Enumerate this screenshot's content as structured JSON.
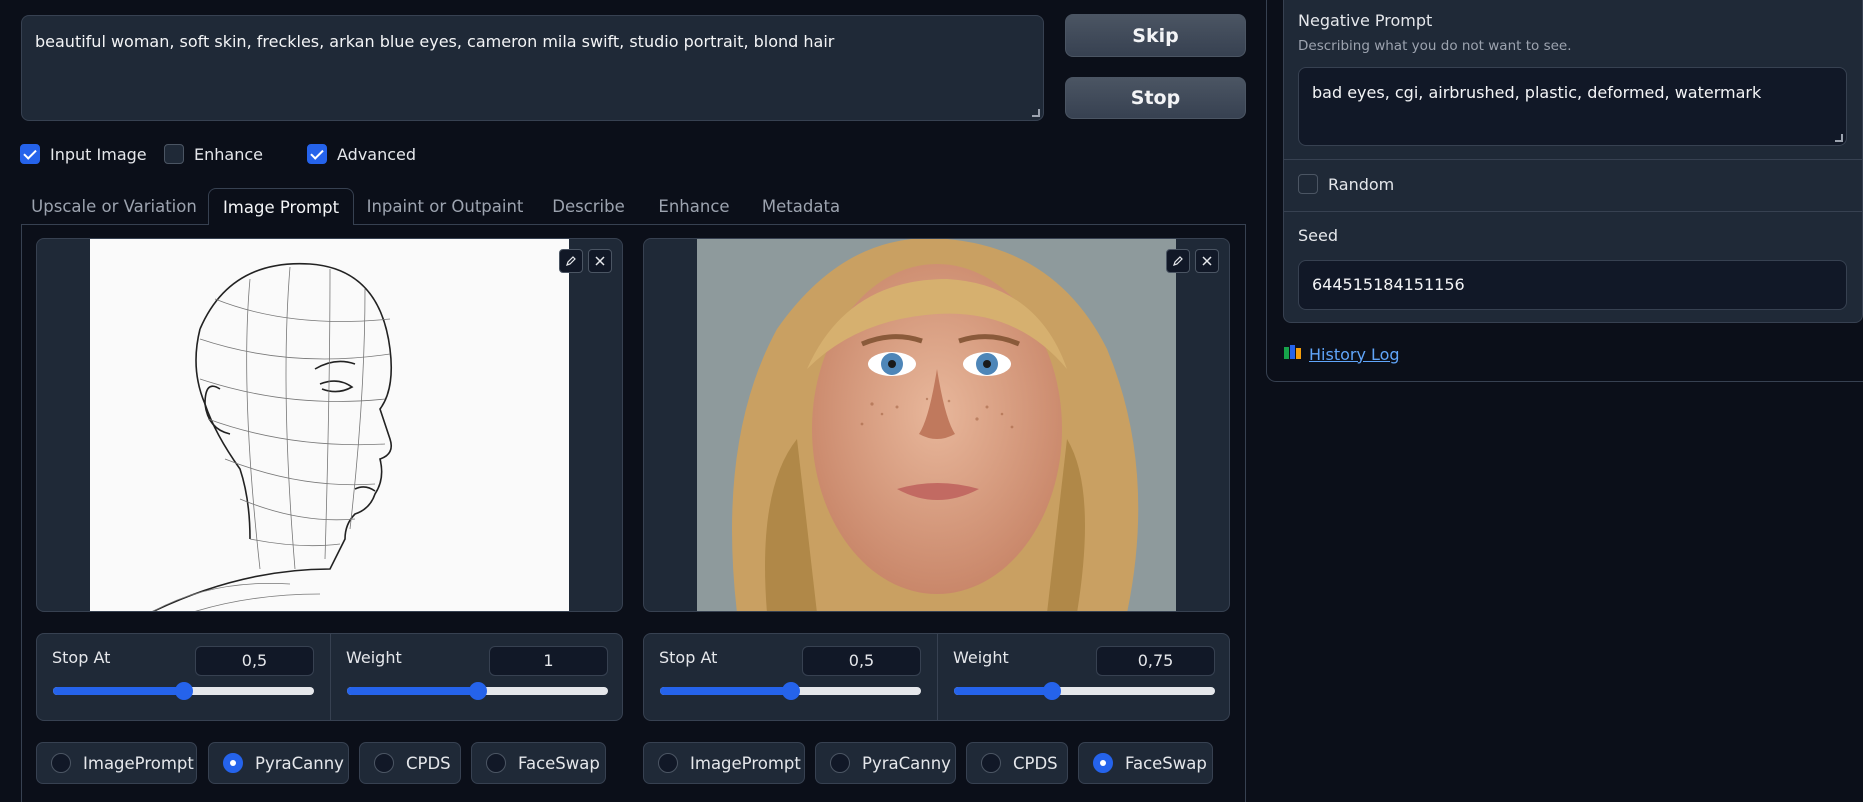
{
  "prompt": {
    "text": "beautiful woman, soft skin, freckles, arkan blue eyes, cameron mila swift, studio portrait, blond hair"
  },
  "buttons": {
    "skip": "Skip",
    "stop": "Stop"
  },
  "options": {
    "input_image": {
      "label": "Input Image",
      "checked": true
    },
    "enhance": {
      "label": "Enhance",
      "checked": false
    },
    "advanced": {
      "label": "Advanced",
      "checked": true
    }
  },
  "tabs": [
    {
      "label": "Upscale or Variation",
      "active": false
    },
    {
      "label": "Image Prompt",
      "active": true
    },
    {
      "label": "Inpaint or Outpaint",
      "active": false
    },
    {
      "label": "Describe",
      "active": false
    },
    {
      "label": "Enhance",
      "active": false
    },
    {
      "label": "Metadata",
      "active": false
    }
  ],
  "image_slots": [
    {
      "image_icon": "wireframe-head-sketch",
      "stop_at": {
        "label": "Stop At",
        "value": "0,5",
        "fraction": 0.5
      },
      "weight": {
        "label": "Weight",
        "value": "1",
        "fraction": 0.5
      },
      "types": [
        "ImagePrompt",
        "PyraCanny",
        "CPDS",
        "FaceSwap"
      ],
      "selected_type": "PyraCanny"
    },
    {
      "image_icon": "freckled-woman-portrait",
      "stop_at": {
        "label": "Stop At",
        "value": "0,5",
        "fraction": 0.5
      },
      "weight": {
        "label": "Weight",
        "value": "0,75",
        "fraction": 0.375
      },
      "types": [
        "ImagePrompt",
        "PyraCanny",
        "CPDS",
        "FaceSwap"
      ],
      "selected_type": "FaceSwap"
    }
  ],
  "right_panel": {
    "negative_prompt": {
      "label": "Negative Prompt",
      "description": "Describing what you do not want to see.",
      "value": "bad eyes, cgi, airbrushed, plastic, deformed, watermark"
    },
    "random": {
      "label": "Random",
      "checked": false
    },
    "seed": {
      "label": "Seed",
      "value": "644515184151156"
    },
    "history_log": {
      "icon": "books-icon",
      "label": "History Log"
    }
  },
  "colors": {
    "accent": "#2563eb",
    "background": "#0b0f19",
    "panel": "#1f2937",
    "link": "#60a5fa"
  }
}
